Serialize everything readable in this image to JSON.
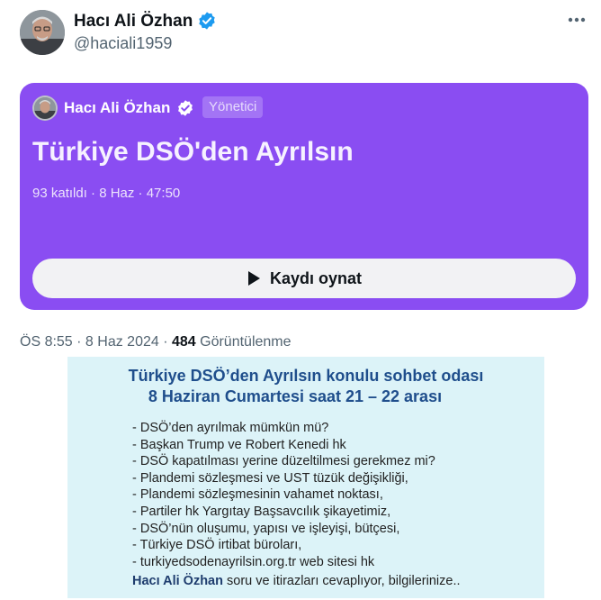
{
  "tweet": {
    "author": {
      "name": "Hacı Ali Özhan",
      "handle": "@haciali1959"
    },
    "timestamp": "ÖS 8:55 · 8 Haz 2024 · ",
    "views_count": "484",
    "views_label": " Görüntülenme"
  },
  "space": {
    "host_name": "Hacı Ali Özhan",
    "role": "Yönetici",
    "title": "Türkiye DSÖ'den Ayrılsın",
    "meta": "93 katıldı · 8 Haz · 47:50",
    "play_label": "Kaydı oynat",
    "background_color": "#8a4df2"
  },
  "notice": {
    "title_line1": "Türkiye DSÖ’den Ayrılsın konulu sohbet odası",
    "title_line2": "8 Haziran Cumartesi saat  21 – 22 arası",
    "topics": [
      "- DSÖ’den ayrılmak mümkün mü?",
      "- Başkan Trump ve Robert Kenedi hk",
      "- DSÖ kapatılması yerine düzeltilmesi gerekmez mi?",
      "- Plandemi sözleşmesi ve UST tüzük değişikliği,",
      "- Plandemi sözleşmesinin vahamet noktası,",
      "- Partiler hk Yargıtay Başsavcılık şikayetimiz,",
      "- DSÖ’nün oluşumu, yapısı ve işleyişi, bütçesi,",
      "- Türkiye DSÖ irtibat büroları,",
      "- turkiyedsodenayrilsin.org.tr web sitesi hk"
    ],
    "closing_name": "Hacı Ali Özhan",
    "closing_text": " soru ve itirazları cevaplıyor, bilgilerinize..",
    "background_color": "#dcf3f8"
  },
  "icons": {
    "verified": "verified-badge-icon",
    "more": "more-options-icon",
    "play": "play-icon"
  }
}
